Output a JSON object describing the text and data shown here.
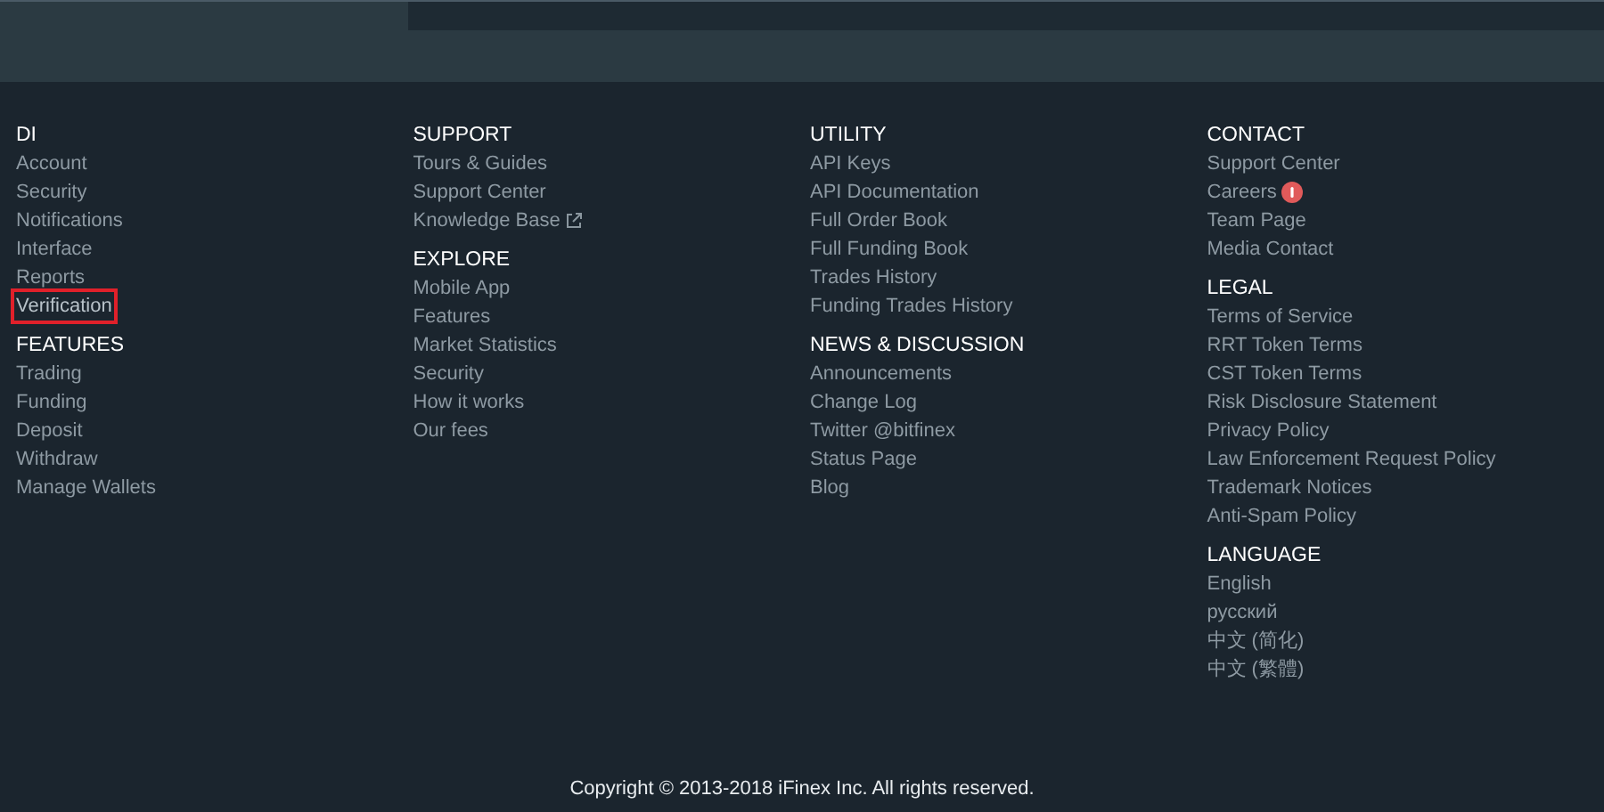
{
  "columns": [
    {
      "sections": [
        {
          "title": "DI",
          "links": [
            {
              "label": "Account"
            },
            {
              "label": "Security"
            },
            {
              "label": "Notifications"
            },
            {
              "label": "Interface"
            },
            {
              "label": "Reports"
            },
            {
              "label": "Verification",
              "highlighted": true
            }
          ]
        },
        {
          "title": "FEATURES",
          "links": [
            {
              "label": "Trading"
            },
            {
              "label": "Funding"
            },
            {
              "label": "Deposit"
            },
            {
              "label": "Withdraw"
            },
            {
              "label": "Manage Wallets"
            }
          ]
        }
      ]
    },
    {
      "sections": [
        {
          "title": "SUPPORT",
          "links": [
            {
              "label": "Tours & Guides"
            },
            {
              "label": "Support Center"
            },
            {
              "label": "Knowledge Base",
              "external": true
            }
          ]
        },
        {
          "title": "EXPLORE",
          "links": [
            {
              "label": "Mobile App"
            },
            {
              "label": "Features"
            },
            {
              "label": "Market Statistics"
            },
            {
              "label": "Security"
            },
            {
              "label": "How it works"
            },
            {
              "label": "Our fees"
            }
          ]
        }
      ]
    },
    {
      "sections": [
        {
          "title": "UTILITY",
          "links": [
            {
              "label": "API Keys"
            },
            {
              "label": "API Documentation"
            },
            {
              "label": "Full Order Book"
            },
            {
              "label": "Full Funding Book"
            },
            {
              "label": "Trades History"
            },
            {
              "label": "Funding Trades History"
            }
          ]
        },
        {
          "title": "NEWS & DISCUSSION",
          "links": [
            {
              "label": "Announcements"
            },
            {
              "label": "Change Log"
            },
            {
              "label": "Twitter @bitfinex"
            },
            {
              "label": "Status Page"
            },
            {
              "label": "Blog"
            }
          ]
        }
      ]
    },
    {
      "sections": [
        {
          "title": "CONTACT",
          "links": [
            {
              "label": "Support Center"
            },
            {
              "label": "Careers",
              "badge": true
            },
            {
              "label": "Team Page"
            },
            {
              "label": "Media Contact"
            }
          ]
        },
        {
          "title": "LEGAL",
          "links": [
            {
              "label": "Terms of Service"
            },
            {
              "label": "RRT Token Terms"
            },
            {
              "label": "CST Token Terms"
            },
            {
              "label": "Risk Disclosure Statement"
            },
            {
              "label": "Privacy Policy"
            },
            {
              "label": "Law Enforcement Request Policy"
            },
            {
              "label": "Trademark Notices"
            },
            {
              "label": "Anti-Spam Policy"
            }
          ]
        },
        {
          "title": "LANGUAGE",
          "links": [
            {
              "label": "English"
            },
            {
              "label": "русский"
            },
            {
              "label": "中文 (简化)"
            },
            {
              "label": "中文 (繁體)"
            }
          ]
        }
      ]
    }
  ],
  "copyright": "Copyright © 2013-2018 iFinex Inc. All rights reserved."
}
